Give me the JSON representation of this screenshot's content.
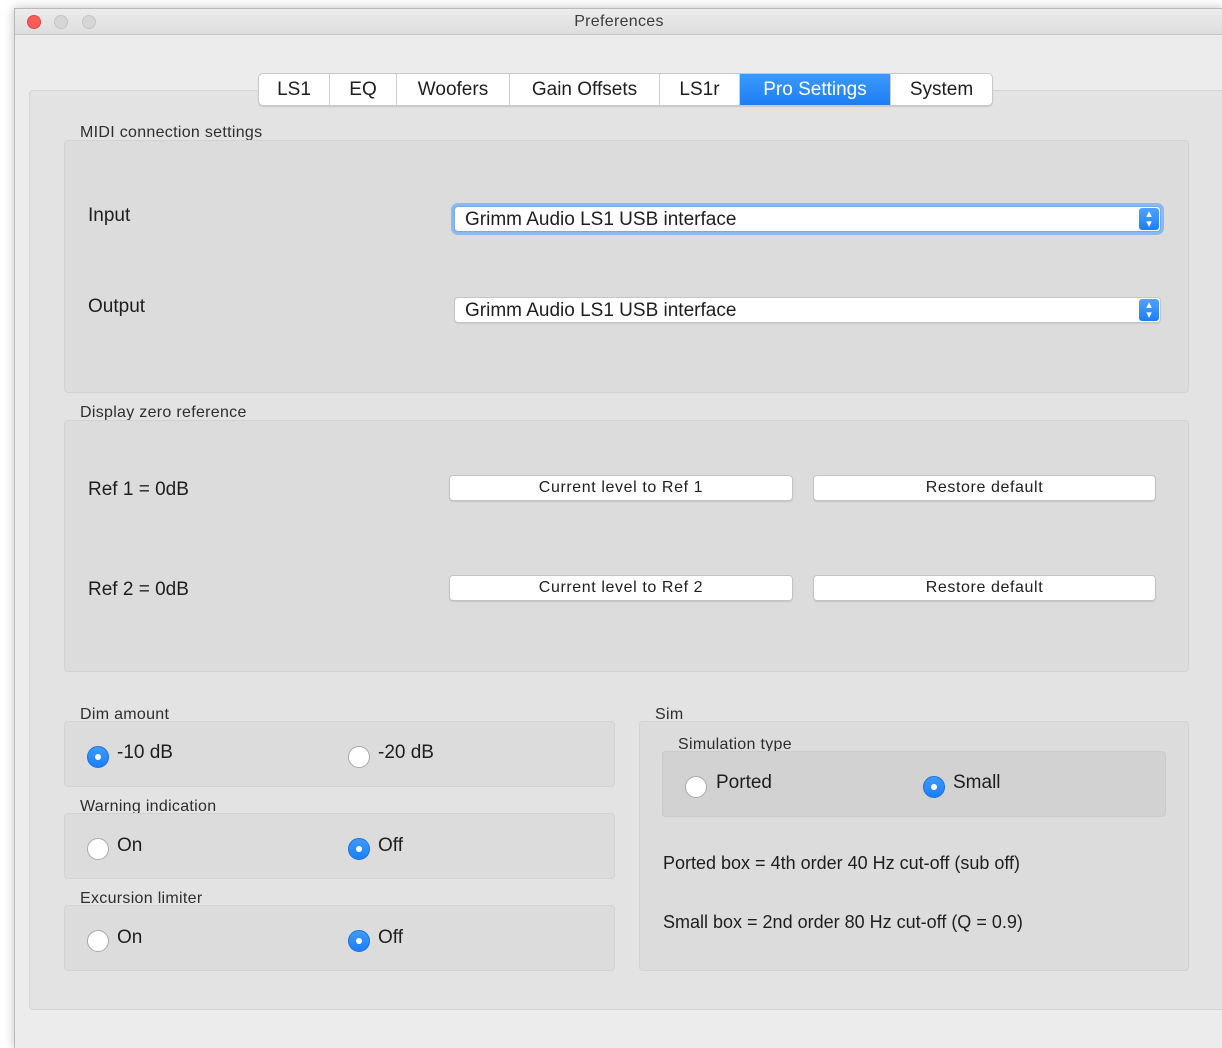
{
  "window": {
    "title": "Preferences"
  },
  "tabs": [
    {
      "label": "LS1",
      "active": false
    },
    {
      "label": "EQ",
      "active": false
    },
    {
      "label": "Woofers",
      "active": false
    },
    {
      "label": "Gain Offsets",
      "active": false
    },
    {
      "label": "LS1r",
      "active": false
    },
    {
      "label": "Pro Settings",
      "active": true
    },
    {
      "label": "System",
      "active": false
    }
  ],
  "midi": {
    "group_label": "MIDI connection settings",
    "input_label": "Input",
    "input_value": "Grimm Audio LS1 USB interface",
    "output_label": "Output",
    "output_value": "Grimm Audio LS1 USB interface"
  },
  "display_zero": {
    "group_label": "Display zero reference",
    "ref1_label": "Ref 1 = 0dB",
    "ref1_button": "Current level to Ref 1",
    "ref1_restore": "Restore default",
    "ref2_label": "Ref 2 = 0dB",
    "ref2_button": "Current level to Ref 2",
    "ref2_restore": "Restore default"
  },
  "dim_amount": {
    "group_label": "Dim amount",
    "option1": "-10 dB",
    "option2": "-20 dB",
    "selected": "-10 dB"
  },
  "warning_indication": {
    "group_label": "Warning indication",
    "option1": "On",
    "option2": "Off",
    "selected": "Off"
  },
  "excursion_limiter": {
    "group_label": "Excursion limiter",
    "option1": "On",
    "option2": "Off",
    "selected": "Off"
  },
  "sim": {
    "group_label": "Sim",
    "simulation_type_label": "Simulation type",
    "option1": "Ported",
    "option2": "Small",
    "selected": "Small",
    "ported_info": "Ported box = 4th order 40 Hz cut-off (sub off)",
    "small_info": "Small box = 2nd order 80 Hz cut-off (Q = 0.9)"
  },
  "colors": {
    "accent": "#1e7ff5",
    "close_button": "#fc5b57",
    "window_bg": "#ececec"
  }
}
